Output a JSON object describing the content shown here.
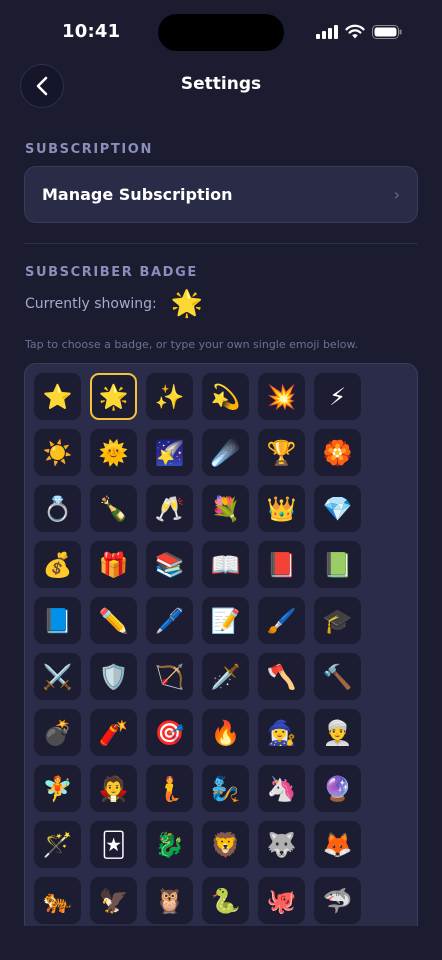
{
  "status_bar": {
    "time": "10:41"
  },
  "nav": {
    "title": "Settings"
  },
  "subscription": {
    "header": "SUBSCRIPTION",
    "manage_label": "Manage Subscription",
    "chevron": "›"
  },
  "badge": {
    "header": "SUBSCRIBER BADGE",
    "current_label": "Currently showing:",
    "current_emoji": "🌟",
    "hint": "Tap to choose a badge, or type your own single emoji below.",
    "selected_index": 1,
    "accent_color": "#f3c33a",
    "emojis": [
      "⭐",
      "🌟",
      "✨",
      "💫",
      "💥",
      "⚡",
      "☀️",
      "🌞",
      "🌠",
      "☄️",
      "🏆",
      "🏵️",
      "💍",
      "🍾",
      "🥂",
      "💐",
      "👑",
      "💎",
      "💰",
      "🎁",
      "📚",
      "📖",
      "📕",
      "📗",
      "📘",
      "✏️",
      "🖊️",
      "📝",
      "🖌️",
      "🎓",
      "⚔️",
      "🛡️",
      "🏹",
      "🗡️",
      "🪓",
      "🔨",
      "💣",
      "🧨",
      "🎯",
      "🔥",
      "🧙‍♀️",
      "👳‍♂️",
      "🧚",
      "🧛",
      "🧜",
      "🧞",
      "🦄",
      "🔮",
      "🪄",
      "🃏",
      "🐉",
      "🦁",
      "🐺",
      "🦊",
      "🐅",
      "🦅",
      "🦉",
      "🐍",
      "🐙",
      "🦈"
    ]
  }
}
